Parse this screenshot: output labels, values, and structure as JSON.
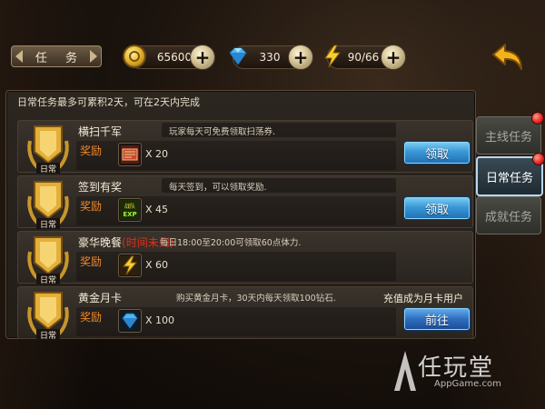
{
  "header": {
    "title": "任 务",
    "gold": "65600",
    "diamonds": "330",
    "stamina": "90/66"
  },
  "panel": {
    "note": "日常任务最多可累积2天，可在2天内完成"
  },
  "badge_label": "日常",
  "reward_label": "奖励",
  "tasks": [
    {
      "name": "横扫千军",
      "desc": "玩家每天可免费领取扫荡券.",
      "qty": "X 20",
      "button": "领取",
      "item": "sweep-ticket-icon"
    },
    {
      "name": "签到有奖",
      "desc": "每天签到，可以领取奖励.",
      "qty": "X 45",
      "button": "领取",
      "item": "team-exp-icon",
      "item_text": "战队EXP"
    },
    {
      "name": "豪华晚餐",
      "warn": "(时间未到)",
      "desc": "每日18:00至20:00可领取60点体力.",
      "qty": "X 60",
      "item": "stamina-icon"
    },
    {
      "name": "黄金月卡",
      "desc": "购买黄金月卡，30天内每天领取100钻石.",
      "qty": "X 100",
      "button": "前往",
      "extra": "充值成为月卡用户",
      "item": "diamond-icon"
    }
  ],
  "side_tabs": [
    {
      "label": "主线任务",
      "active": false,
      "dot": true
    },
    {
      "label": "日常任务",
      "active": true,
      "dot": true
    },
    {
      "label": "成就任务",
      "active": false,
      "dot": false
    }
  ],
  "watermark": {
    "big": "任玩堂",
    "small": "AppGame.com"
  },
  "colors": {
    "button_blue": "#3a98d6",
    "reward_orange": "#f0882a",
    "warn_red": "#e0301c",
    "badge_gold": "#e2b03a"
  }
}
